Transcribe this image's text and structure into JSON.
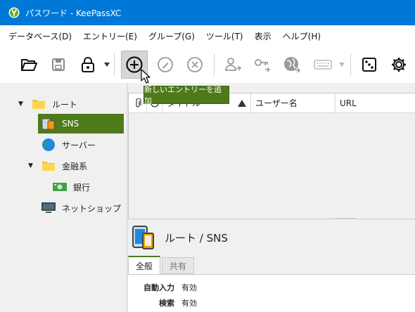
{
  "window": {
    "title": "パスワード - KeePassXC"
  },
  "menu": [
    "データベース(D)",
    "エントリー(E)",
    "グループ(G)",
    "ツール(T)",
    "表示",
    "ヘルプ(H)"
  ],
  "toolbar": {
    "tooltip": "新しいエントリーを追加",
    "icons": [
      "folder-open-icon",
      "save-icon",
      "lock-icon",
      "add-entry-icon",
      "edit-entry-icon",
      "delete-entry-icon",
      "copy-username-icon",
      "copy-password-icon",
      "open-url-icon",
      "autotype-keyboard-icon",
      "password-generator-icon",
      "settings-icon"
    ]
  },
  "tree": {
    "items": [
      {
        "label": "ルート",
        "icon": "folder-icon"
      },
      {
        "label": "SNS",
        "icon": "device-icon"
      },
      {
        "label": "サーバー",
        "icon": "globe-icon"
      },
      {
        "label": "金融系",
        "icon": "folder-icon"
      },
      {
        "label": "銀行",
        "icon": "money-icon"
      },
      {
        "label": "ネットショップ",
        "icon": "monitor-icon"
      }
    ]
  },
  "table": {
    "columns": [
      "タイトル",
      "ユーザー名",
      "URL"
    ]
  },
  "details": {
    "path": "ルート / SNS",
    "tabs": [
      "全般",
      "共有"
    ],
    "fields": [
      {
        "key": "自動入力",
        "value": "有効"
      },
      {
        "key": "検索",
        "value": "有効"
      }
    ]
  },
  "colors": {
    "titlebar": "#0078d7",
    "accent": "#4e7a1a"
  }
}
